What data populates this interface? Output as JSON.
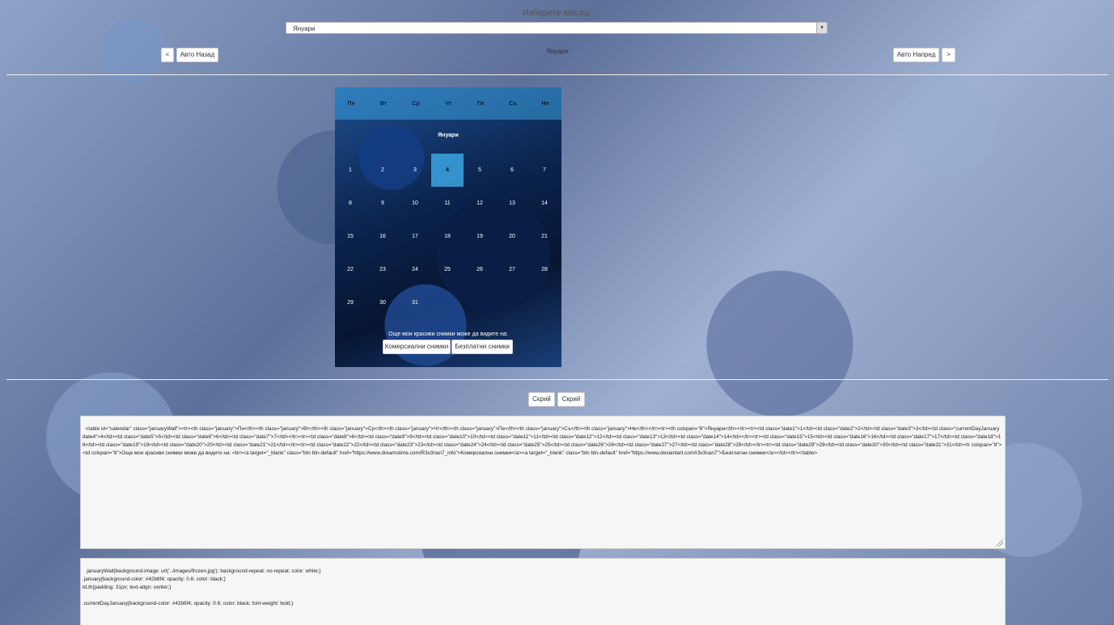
{
  "month_picker": {
    "label": "Изберете месец:",
    "selected": "Януари"
  },
  "nav": {
    "prev": "<",
    "auto_back": "Авто Назад",
    "current_month": "Януари",
    "auto_forward": "Авто Напред",
    "next": ">"
  },
  "calendar": {
    "weekdays": [
      "Пн",
      "Вт",
      "Ср",
      "Чт",
      "Пе",
      "Съ",
      "Не"
    ],
    "month_title": "Януари",
    "weeks": [
      [
        "1",
        "2",
        "3",
        "4",
        "5",
        "6",
        "7"
      ],
      [
        "8",
        "9",
        "10",
        "11",
        "12",
        "13",
        "14"
      ],
      [
        "15",
        "16",
        "17",
        "18",
        "19",
        "20",
        "21"
      ],
      [
        "22",
        "23",
        "24",
        "25",
        "26",
        "27",
        "28"
      ],
      [
        "29",
        "30",
        "31",
        "",
        "",
        "",
        ""
      ]
    ],
    "current_day": "4",
    "footer_text": "Още мои красиви снимки може да видите на:",
    "commercial_button": "Комерсиални снимки",
    "free_button": "Безплатни снимки"
  },
  "hide_buttons": {
    "hide_html": "Скрий",
    "hide_css": "Скрий"
  },
  "html_code": "<table id=\"calendar\" class=\"januaryWall\"><tr><th class=\"january\">Пн</th><th class=\"january\">Вт</th><th class=\"january\">Ср</th><th class=\"january\">Чт</th><th class=\"january\">Пе</th><th class=\"january\">Съ</th><th class=\"january\">Не</th></tr><tr><th colspan=\"8\">Януари</th></tr><tr><td class=\"date1\">1</td><td class=\"date2\">2</td><td class=\"date3\">3</td><td class=\"currentDayJanuary date4\">4</td><td class=\"date5\">5</td><td class=\"date6\">6</td><td class=\"date7\">7</td></tr><tr><td class=\"date8\">8</td><td class=\"date9\">9</td><td class=\"date10\">10</td><td class=\"date11\">11</td><td class=\"date12\">12</td><td class=\"date13\">13</td><td class=\"date14\">14</td></tr><tr><td class=\"date15\">15</td><td class=\"date16\">16</td><td class=\"date17\">17</td><td class=\"date18\">18</td><td class=\"date19\">19</td><td class=\"date20\">20</td><td class=\"date21\">21</td></tr><tr><td class=\"date22\">22</td><td class=\"date23\">23</td><td class=\"date24\">24</td><td class=\"date25\">25</td><td class=\"date26\">26</td><td class=\"date27\">27</td><td class=\"date28\">28</td></tr><tr><td class=\"date29\">29</td><td class=\"date30\">30</td><td class=\"date31\">31</td><tr colspan=\"8\"><td colspan=\"8\">Още мои красиви снимки може да видите на: <br><a target=\"_blank\" class=\"btn btn-default\" href=\"https://www.dreamstime.com/R3v3nan7_info\">Комерсиални снимки</a><a target=\"_blank\" class=\"btn btn-default\" href=\"https://www.deviantart.com/r3v3nan7\">Безплатни снимки</a></td></tr></table>",
  "css_code": ".januaryWall{background-image: url('../images/frozen.jpg'); background-repeat: no-repeat; color: white;}\n.january{background-color: #42b6f4; opacity: 0.6; color: black;}\ntd,th{padding: 31px; text-align: center;}\n\n.currentDayJanuary{background-color: #42b6f4; opacity: 0.6; color: black; font-weight: bold;}"
}
